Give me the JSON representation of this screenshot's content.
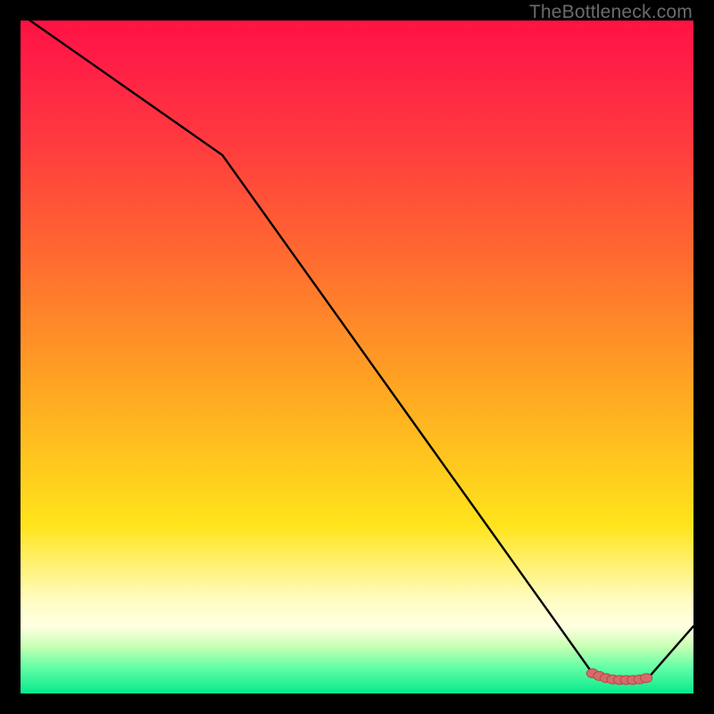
{
  "watermark": "TheBottleneck.com",
  "colors": {
    "background": "#000000",
    "gradient_top": "#ff1244",
    "gradient_mid1": "#ff6a30",
    "gradient_mid2": "#ffe41b",
    "gradient_pale": "#ffffe2",
    "gradient_bottom": "#06e98d",
    "line": "#000000",
    "marker_fill": "#d76a6a",
    "marker_stroke": "#b74747"
  },
  "chart_data": {
    "type": "line",
    "title": "",
    "xlabel": "",
    "ylabel": "",
    "xlim": [
      0,
      100
    ],
    "ylim": [
      0,
      100
    ],
    "x": [
      0,
      10,
      20,
      30,
      40,
      50,
      60,
      70,
      80,
      85,
      88,
      90,
      93,
      100
    ],
    "y": [
      101,
      94,
      87,
      80,
      66,
      52,
      38,
      24,
      10,
      3,
      2,
      2,
      2,
      10
    ],
    "markers": {
      "x": [
        85,
        86,
        87,
        88,
        89,
        90,
        91,
        92,
        93
      ],
      "y": [
        3,
        2.6,
        2.3,
        2.1,
        2.0,
        2.0,
        2.0,
        2.1,
        2.3
      ]
    }
  }
}
